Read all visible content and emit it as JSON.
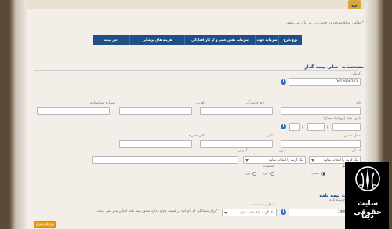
{
  "header": {
    "logo_glyph": "ب",
    "note": "* تمامی مبالغ موجود در جدول زیر به ریال می باشد."
  },
  "table": {
    "headers": [
      "نوع طرح",
      "سرمایه فوت",
      "سرمایه نقص عضو و از کار افتادگی",
      "هزینه های پزشکی",
      "حق بیمه"
    ]
  },
  "policyholder": {
    "section_title": "مشخصات اصلی بیمه گذار",
    "national_code": {
      "label": "کدملی",
      "value": "0012938743"
    },
    "name": {
      "label": "نام"
    },
    "family": {
      "label": "نام خانوادگی"
    },
    "father": {
      "label": "نام پدر"
    },
    "id_number": {
      "label": "شماره شناسنامه"
    },
    "birth_date": {
      "label": "تاریخ تولد (روز/ماه/سال)",
      "sep": "/"
    },
    "issue_place": {
      "label": "محل صدور"
    },
    "phone": {
      "label": "تلفن"
    },
    "mobile": {
      "label": "تلفن همراه"
    },
    "province": {
      "label": "استان",
      "value": "یک گزینه را انتخاب نمایید"
    },
    "city": {
      "label": "شهر",
      "value": "یک گزینه را انتخاب نمایید"
    },
    "address": {
      "label": "آدرس"
    },
    "marital": {
      "label": "وضعیت تاهل",
      "options": [
        "متاهل",
        "مجرد"
      ]
    },
    "gender": {
      "label": "جنسیت",
      "options": [
        "مرد",
        "زن"
      ]
    }
  },
  "insured": {
    "section_title": "مشخصات بیمه نامه",
    "start_date": {
      "label": "تاریخ شروع بیمه نامه",
      "value": "1400/11/26"
    },
    "job_class": {
      "label": "شغل بیمه شده",
      "value": "یک گزینه را انتخاب نمایید"
    },
    "warning": "*برای مشاغلی که نام آنها در لیست وجود ندارد صدور بیمه نامه امکان پذیر نمی باشد."
  },
  "actions": {
    "next_label": "مرحله بعدی"
  },
  "watermark": {
    "line1": "سایت حقوقی",
    "line2": "دینا"
  },
  "icons": {
    "info": "i",
    "info_color": "#2d6fc4",
    "accent": "#1e4f86",
    "button": "#f0a21a"
  }
}
